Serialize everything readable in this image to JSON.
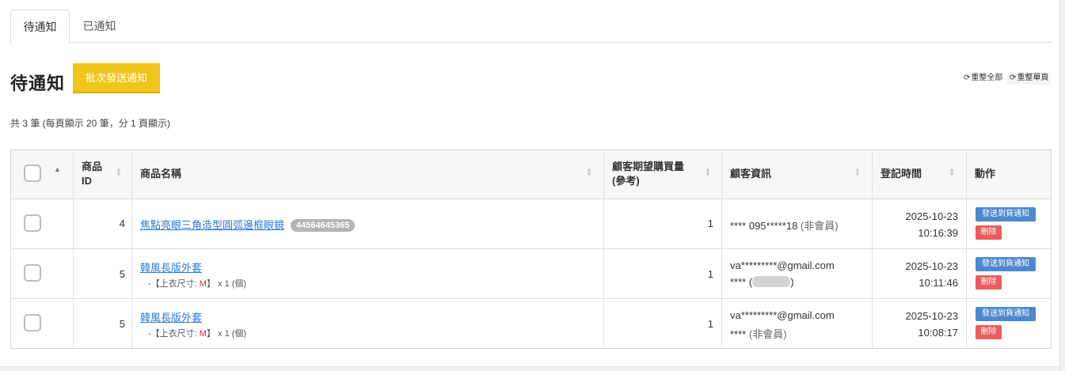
{
  "tabs": [
    {
      "label": "待通知",
      "active": true
    },
    {
      "label": "已通知",
      "active": false
    }
  ],
  "page": {
    "title": "待通知",
    "batch_button": "批次發送通知",
    "reorder_all": "重整全部",
    "reorder_page": "重整單頁",
    "summary": "共 3 筆 (每頁顯示 20 筆，分 1 頁顯示)"
  },
  "table": {
    "headers": {
      "product_id_line1": "商品",
      "product_id_line2": "ID",
      "product_name": "商品名稱",
      "qty_line1": "顧客期望購買量",
      "qty_line2": "(參考)",
      "customer": "顧客資訊",
      "time": "登記時間",
      "action": "動作"
    },
    "action_notify": "發送到貨通知",
    "action_delete": "刪除",
    "rows": [
      {
        "id": "4",
        "name": "焦點亮眼三角造型圓弧邊框眼鏡",
        "sku": "44564645365",
        "variant_prefix": "",
        "variant_value": "",
        "variant_suffix": "",
        "qty": "1",
        "cust_line1": "**** 095*****18",
        "cust_line1_note": "(非會員)",
        "cust_line2": "",
        "cust_line2_note": "",
        "date": "2025-10-23",
        "clock": "10:16:39"
      },
      {
        "id": "5",
        "name": "韓風長版外套",
        "sku": "",
        "variant_prefix": "-【上衣尺寸: ",
        "variant_value": "M",
        "variant_suffix": "】 x 1 (個)",
        "qty": "1",
        "cust_line1": "va*********@gmail.com",
        "cust_line1_note": "",
        "cust_line2": "**** (",
        "cust_line2_note": ")",
        "date": "2025-10-23",
        "clock": "10:11:46"
      },
      {
        "id": "5",
        "name": "韓風長版外套",
        "sku": "",
        "variant_prefix": "-【上衣尺寸: ",
        "variant_value": "M",
        "variant_suffix": "】 x 1 (個)",
        "qty": "1",
        "cust_line1": "va*********@gmail.com",
        "cust_line1_note": "",
        "cust_line2": "****",
        "cust_line2_note": "(非會員)",
        "date": "2025-10-23",
        "clock": "10:08:17"
      }
    ]
  },
  "colors": {
    "batch_button": "#f0c419",
    "link": "#2a7ad6",
    "notify_button": "#4b88cf",
    "delete_button": "#e85d5d",
    "variant_value": "#c9302c"
  }
}
